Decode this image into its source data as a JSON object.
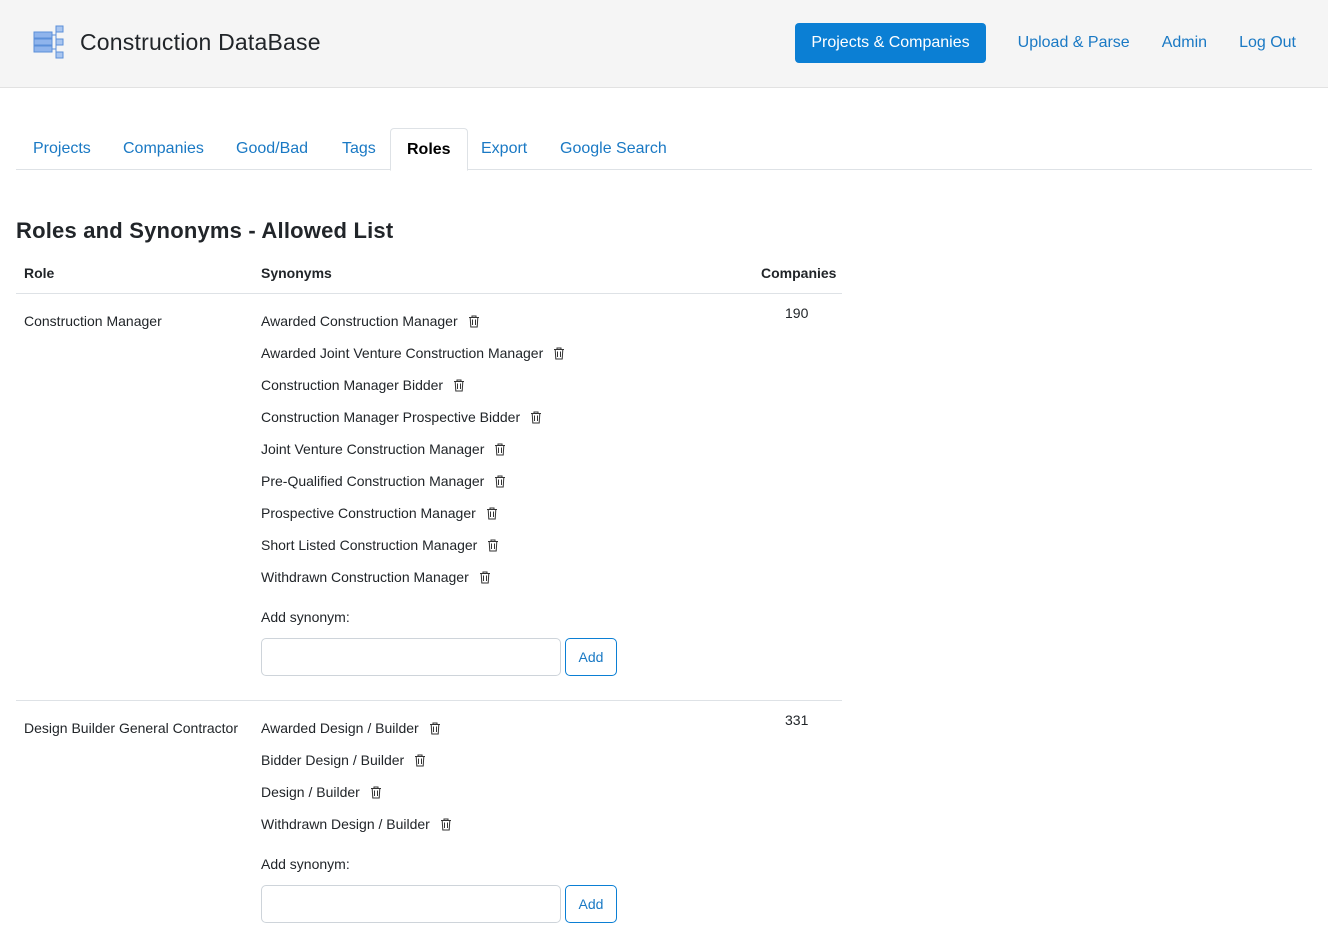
{
  "app": {
    "title": "Construction DataBase"
  },
  "nav": {
    "projects_companies": "Projects & Companies",
    "upload_parse": "Upload & Parse",
    "admin": "Admin",
    "logout": "Log Out"
  },
  "tabs": [
    "Projects",
    "Companies",
    "Good/Bad",
    "Tags",
    "Roles",
    "Export",
    "Google Search"
  ],
  "active_tab": "Roles",
  "page_title": "Roles and Synonyms - Allowed List",
  "table": {
    "headers": {
      "role": "Role",
      "synonyms": "Synonyms",
      "companies": "Companies"
    },
    "rows": [
      {
        "role": "Construction Manager",
        "companies": "190",
        "synonyms": [
          "Awarded Construction Manager",
          "Awarded Joint Venture Construction Manager",
          "Construction Manager Bidder",
          "Construction Manager Prospective Bidder",
          "Joint Venture Construction Manager",
          "Pre-Qualified Construction Manager",
          "Prospective Construction Manager",
          "Short Listed Construction Manager",
          "Withdrawn Construction Manager"
        ],
        "add_label": "Add synonym:",
        "add_value": "",
        "add_button": "Add"
      },
      {
        "role": "Design Builder General Contractor",
        "companies": "331",
        "synonyms": [
          "Awarded Design / Builder",
          "Bidder Design / Builder",
          "Design / Builder",
          "Withdrawn Design / Builder"
        ],
        "add_label": "Add synonym:",
        "add_value": "",
        "add_button": "Add"
      }
    ]
  },
  "icons": {
    "brand": "database-icon",
    "delete": "trash-icon"
  },
  "colors": {
    "primary": "#0b7fd4",
    "link": "#1a79c4"
  }
}
